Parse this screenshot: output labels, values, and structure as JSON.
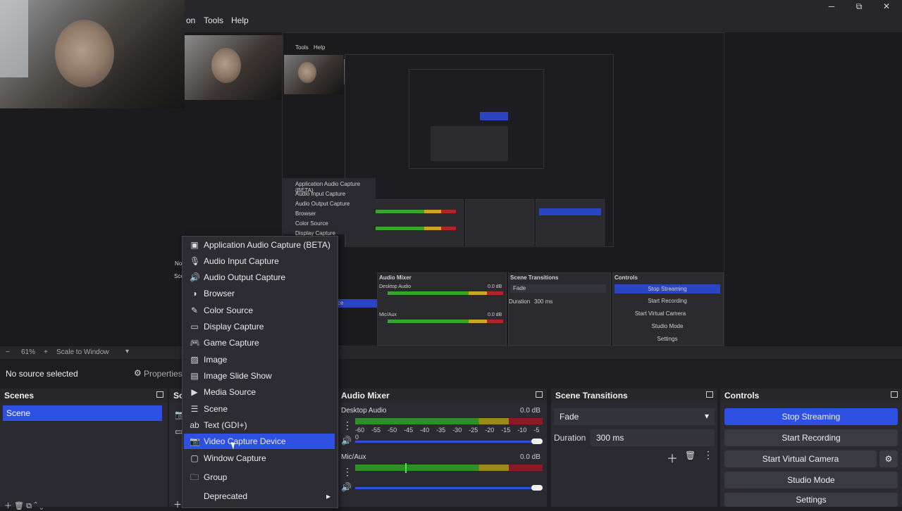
{
  "menu": {
    "partial_item": "on",
    "tools": "Tools",
    "help": "Help"
  },
  "window_controls": {
    "minimize": "─",
    "maximize": "⧉",
    "close": "✕"
  },
  "nested_preview": {
    "menu_tools": "Tools",
    "menu_help": "Help",
    "context_items": [
      "Application Audio Capture (BETA)",
      "Audio Input Capture",
      "Audio Output Capture",
      "Browser",
      "Color Source",
      "Display Capture"
    ],
    "audio_mixer_title": "Audio Mixer",
    "desktop_audio": "Desktop Audio",
    "desktop_db": "0.0 dB",
    "mic_aux": "Mic/Aux",
    "mic_db": "0.0 dB",
    "scene_transitions_title": "Scene Transitions",
    "fade": "Fade",
    "duration_label": "Duration",
    "duration_value": "300 ms",
    "controls_title": "Controls",
    "controls": [
      "Stop Streaming",
      "Start Recording",
      "Start Virtual Camera",
      "Studio Mode",
      "Settings"
    ],
    "partial_no": "No",
    "partial_sce": "Sce",
    "partial_ce": "ce"
  },
  "status": {
    "zoom": "61%",
    "scale_mode": "Scale to Window",
    "minus": "−",
    "plus": "+"
  },
  "source_row": {
    "no_source": "No source selected",
    "properties": "Properties"
  },
  "scenes": {
    "title": "Scenes",
    "items": [
      "Scene"
    ]
  },
  "sources": {
    "title_partial": "Sou"
  },
  "audio_mixer": {
    "title": "Audio Mixer",
    "channels": [
      {
        "name": "Desktop Audio",
        "db": "0.0 dB"
      },
      {
        "name": "Mic/Aux",
        "db": "0.0 dB"
      }
    ],
    "tick_labels": [
      "-60",
      "-55",
      "-50",
      "-45",
      "-40",
      "-35",
      "-30",
      "-25",
      "-20",
      "-15",
      "-10",
      "-5",
      "0"
    ]
  },
  "scene_transitions": {
    "title": "Scene Transitions",
    "transition": "Fade",
    "duration_label": "Duration",
    "duration_value": "300 ms"
  },
  "controls": {
    "title": "Controls",
    "stop_streaming": "Stop Streaming",
    "start_recording": "Start Recording",
    "start_virtual_camera": "Start Virtual Camera",
    "studio_mode": "Studio Mode",
    "settings": "Settings"
  },
  "context_menu": {
    "items": [
      {
        "label": "Application Audio Capture (BETA)",
        "icon": "app-audio-icon"
      },
      {
        "label": "Audio Input Capture",
        "icon": "microphone-icon"
      },
      {
        "label": "Audio Output Capture",
        "icon": "speaker-icon"
      },
      {
        "label": "Browser",
        "icon": "globe-icon"
      },
      {
        "label": "Color Source",
        "icon": "brush-icon"
      },
      {
        "label": "Display Capture",
        "icon": "monitor-icon"
      },
      {
        "label": "Game Capture",
        "icon": "gamepad-icon"
      },
      {
        "label": "Image",
        "icon": "image-icon"
      },
      {
        "label": "Image Slide Show",
        "icon": "slideshow-icon"
      },
      {
        "label": "Media Source",
        "icon": "play-icon"
      },
      {
        "label": "Scene",
        "icon": "list-icon"
      },
      {
        "label": "Text (GDI+)",
        "icon": "text-icon"
      },
      {
        "label": "Video Capture Device",
        "icon": "camera-icon"
      },
      {
        "label": "Window Capture",
        "icon": "window-icon"
      },
      {
        "label": "Group",
        "icon": "folder-icon"
      },
      {
        "label": "Deprecated",
        "icon": "submenu-arrow-icon"
      }
    ],
    "selected_index": 12
  },
  "colors": {
    "accent": "#2f51e3",
    "panel": "#2a2a30",
    "background": "#1e1e22",
    "meter_green": "#2f8d2a",
    "meter_yellow": "#9b8a1a",
    "meter_red": "#8a1b22"
  }
}
